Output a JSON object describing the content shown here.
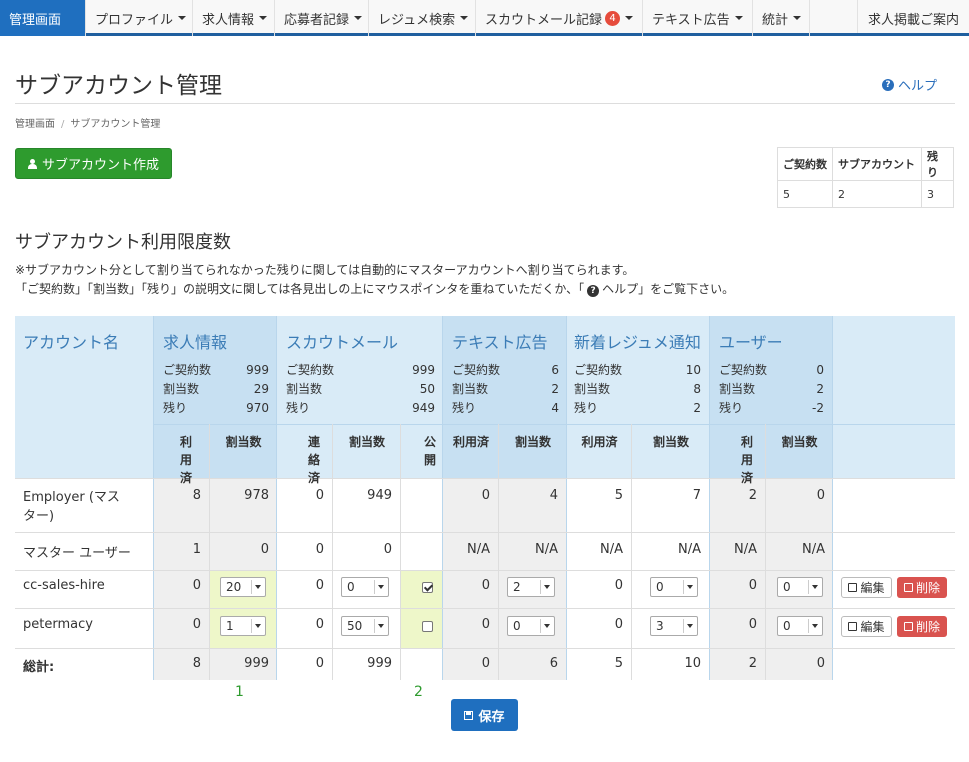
{
  "nav": {
    "items": [
      {
        "label": "管理画面",
        "caret": false
      },
      {
        "label": "プロファイル",
        "caret": true
      },
      {
        "label": "求人情報",
        "caret": true
      },
      {
        "label": "応募者記録",
        "caret": true
      },
      {
        "label": "レジュメ検索",
        "caret": true
      },
      {
        "label": "スカウトメール記録",
        "caret": true,
        "badge": "4"
      },
      {
        "label": "テキスト広告",
        "caret": true
      },
      {
        "label": "統計",
        "caret": true
      }
    ],
    "right_label": "求人掲載ご案内"
  },
  "page": {
    "title": "サブアカウント管理",
    "help": "ヘルプ",
    "breadcrumb": [
      "管理画面",
      "サブアカウント管理"
    ],
    "create_button": "サブアカウント作成",
    "section_title": "サブアカウント利用限度数",
    "note1": "※サブアカウント分として割り当てられなかった残りに関しては自動的にマスターアカウントへ割り当てられます。",
    "note2_a": "「ご契約数」「割当数」「残り」の説明文に関しては各見出しの上にマウスポインタを重ねていただくか、「",
    "note2_b": "ヘルプ」をご覧下さい。",
    "save_button": "保存",
    "annotations": [
      "1",
      "2"
    ]
  },
  "summary": {
    "headers": [
      "ご契約数",
      "サブアカウント",
      "残り"
    ],
    "values": [
      "5",
      "2",
      "3"
    ]
  },
  "table": {
    "account_header": "アカウント名",
    "stat_labels": [
      "ご契約数",
      "割当数",
      "残り"
    ],
    "groups": [
      {
        "title": "求人情報",
        "stats": [
          "999",
          "29",
          "970"
        ],
        "cols": [
          "利用済",
          "割当数"
        ]
      },
      {
        "title": "スカウトメール",
        "stats": [
          "999",
          "50",
          "949"
        ],
        "cols": [
          "連絡済",
          "割当数",
          "公開"
        ]
      },
      {
        "title": "テキスト広告",
        "stats": [
          "6",
          "2",
          "4"
        ],
        "cols": [
          "利用済",
          "割当数"
        ]
      },
      {
        "title": "新着レジュメ通知",
        "stats": [
          "10",
          "8",
          "2"
        ],
        "cols": [
          "利用済",
          "割当数"
        ]
      },
      {
        "title": "ユーザー",
        "stats": [
          "0",
          "2",
          "-2"
        ],
        "cols": [
          "利用済",
          "割当数"
        ]
      }
    ],
    "rows": [
      {
        "name": "Employer (マスター)",
        "name_l1": "Employer (マス",
        "name_l2": "ター)",
        "cells": [
          "8",
          "978",
          "0",
          "949",
          "",
          "0",
          "4",
          "5",
          "7",
          "2",
          "0"
        ]
      },
      {
        "name": "マスター ユーザー",
        "cells": [
          "1",
          "0",
          "0",
          "0",
          "",
          "N/A",
          "N/A",
          "N/A",
          "N/A",
          "N/A",
          "N/A"
        ]
      },
      {
        "name": "cc-sales-hire",
        "cells": [
          "0",
          "20",
          "0",
          "0",
          "checked",
          "0",
          "2",
          "0",
          "0",
          "0",
          "0"
        ],
        "edit": "編集",
        "delete": "削除"
      },
      {
        "name": "petermacy",
        "cells": [
          "0",
          "1",
          "0",
          "50",
          "unchecked",
          "0",
          "0",
          "0",
          "3",
          "0",
          "0"
        ],
        "edit": "編集",
        "delete": "削除"
      }
    ],
    "total": {
      "label": "総計:",
      "cells": [
        "8",
        "999",
        "0",
        "999",
        "",
        "0",
        "6",
        "5",
        "10",
        "2",
        "0"
      ]
    }
  },
  "colors": {
    "brand": "#1f6fbf",
    "create": "#2e9b2e",
    "delete": "#d9534f",
    "highlight": "#eef7c9"
  }
}
